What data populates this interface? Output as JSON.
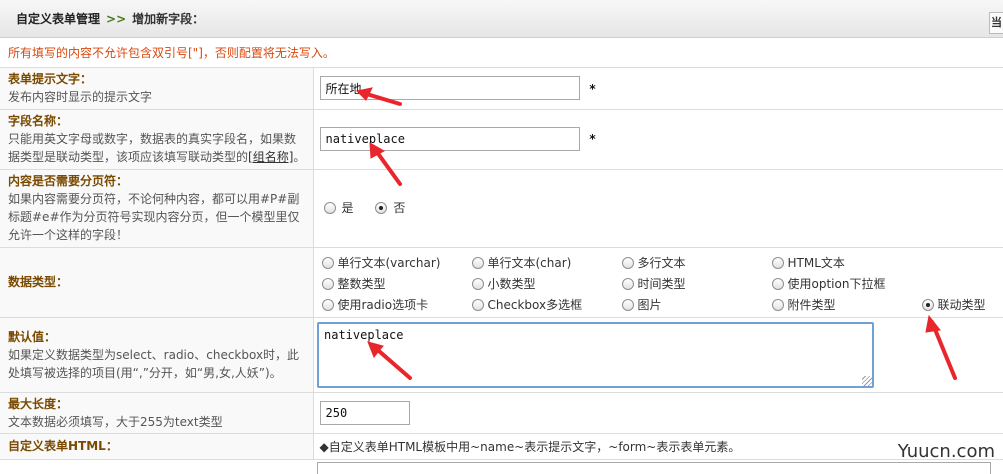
{
  "header": {
    "title": "自定义表单管理",
    "separator": ">>",
    "subtitle": "增加新字段：",
    "corner_label": "当"
  },
  "warning": "所有填写的内容不允许包含双引号[\"]，否则配置将无法写入。",
  "rows": {
    "prompt": {
      "title": "表单提示文字：",
      "desc": "发布内容时显示的提示文字",
      "value": "所在地",
      "required": "*"
    },
    "field_name": {
      "title": "字段名称：",
      "desc": "只能用英文字母或数字，数据表的真实字段名，如果数据类型是联动类型，该项应该填写联动类型的",
      "link": "[组名称]",
      "desc_end": "。",
      "value": "nativeplace",
      "required": "*"
    },
    "paging": {
      "title": "内容是否需要分页符：",
      "desc": "如果内容需要分页符，不论何种内容，都可以用#P#副标题#e#作为分页符号实现内容分页，但一个模型里仅允许一个这样的字段！",
      "yes": "是",
      "no": "否",
      "selected": "no"
    },
    "data_type": {
      "title": "数据类型：",
      "options": [
        "单行文本(varchar)",
        "单行文本(char)",
        "多行文本",
        "HTML文本",
        "整数类型",
        "小数类型",
        "时间类型",
        "使用option下拉框",
        "使用radio选项卡",
        "Checkbox多选框",
        "图片",
        "附件类型",
        "联动类型"
      ],
      "selected": "联动类型"
    },
    "default_value": {
      "title": "默认值：",
      "desc": "如果定义数据类型为select、radio、checkbox时，此处填写被选择的项目(用“,”分开，如“男,女,人妖”)。",
      "value": "nativeplace"
    },
    "max_length": {
      "title": "最大长度：",
      "desc": "文本数据必须填写，大于255为text类型",
      "value": "250"
    },
    "html_template": {
      "title": "自定义表单HTML：",
      "note": "◆自定义表单HTML模板中用~name~表示提示文字，~form~表示表单元素。"
    }
  },
  "watermark": "Yuucn.com",
  "colors": {
    "title": "#7a4a00",
    "warning": "#d9480f",
    "arrow": "#e8262b",
    "focus": "#6fa0d6"
  }
}
